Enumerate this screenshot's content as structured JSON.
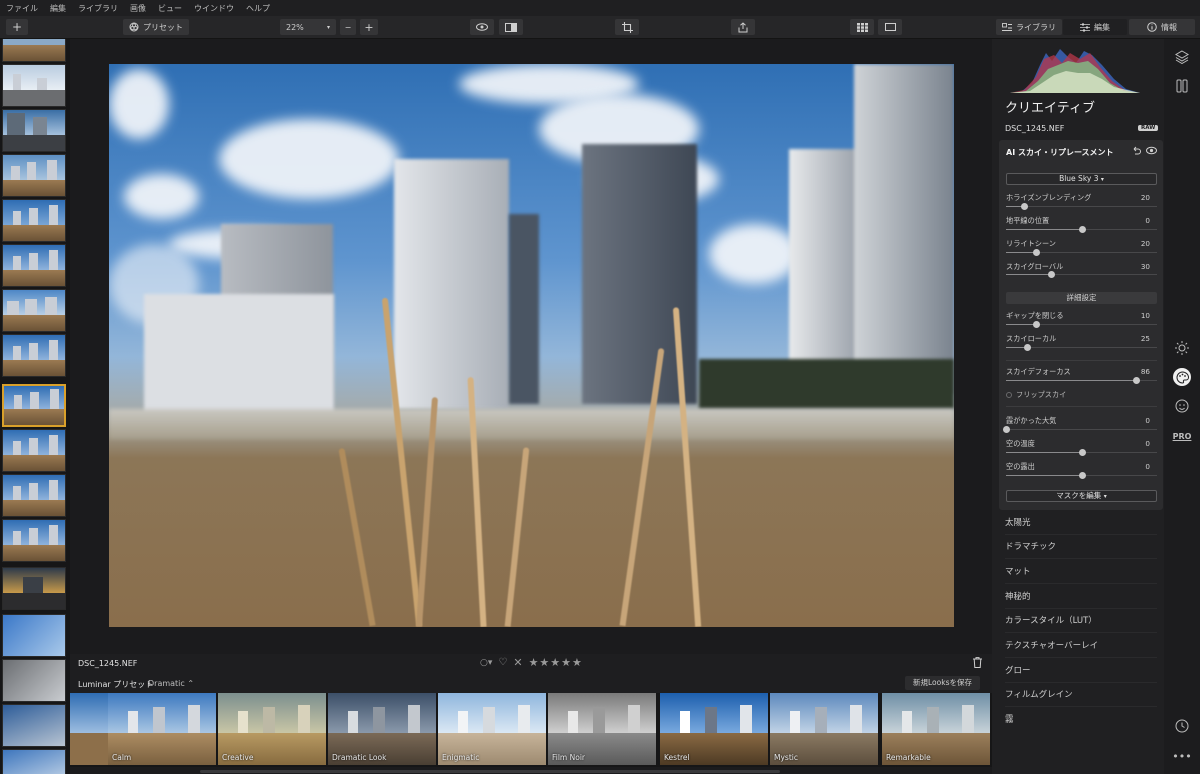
{
  "menu": [
    "ファイル",
    "編集",
    "ライブラリ",
    "画像",
    "ビュー",
    "ウインドウ",
    "ヘルプ"
  ],
  "toolbar": {
    "add_label": "+",
    "preset_label": "プリセット",
    "zoom": "22%",
    "zoom_minus": "−",
    "zoom_plus": "+",
    "tab_library": "ライブラリ",
    "tab_edit": "編集",
    "tab_info": "情報"
  },
  "file": {
    "name": "DSC_1245.NEF",
    "rating_stars": "★★★★★"
  },
  "presets": {
    "group": "Luminar プリセット",
    "category": "Dramatic",
    "save_label": "新規Looksを保存",
    "items": [
      "Calm",
      "Creative",
      "Dramatic Look",
      "Enigmatic",
      "Film Noir",
      "Kestrel",
      "Mystic",
      "Remarkable"
    ]
  },
  "panel": {
    "title": "クリエイティブ",
    "file": "DSC_1245.NEF",
    "badge": "RAW",
    "sky": {
      "title": "AI スカイ・リプレースメント",
      "sky_select": "Blue Sky 3",
      "sliders": [
        {
          "label": "ホライズンブレンディング",
          "value": "20",
          "pos": 0.12
        },
        {
          "label": "地平線の位置",
          "value": "0",
          "pos": 0.5
        },
        {
          "label": "リライトシーン",
          "value": "20",
          "pos": 0.2
        },
        {
          "label": "スカイグローバル",
          "value": "30",
          "pos": 0.3
        }
      ],
      "advanced_label": "詳細設定",
      "adv_sliders": [
        {
          "label": "ギャップを閉じる",
          "value": "10",
          "pos": 0.2
        },
        {
          "label": "スカイローカル",
          "value": "25",
          "pos": 0.14
        }
      ],
      "defocus": {
        "label": "スカイデフォーカス",
        "value": "86",
        "pos": 0.86
      },
      "flip_label": "フリップスカイ",
      "atmo_sliders": [
        {
          "label": "霞がかった大気",
          "value": "0",
          "pos": 0.0
        },
        {
          "label": "空の温度",
          "value": "0",
          "pos": 0.5
        },
        {
          "label": "空の露出",
          "value": "0",
          "pos": 0.5
        }
      ],
      "mask_label": "マスクを編集"
    },
    "tools": [
      "太陽光",
      "ドラマチック",
      "マット",
      "神秘的",
      "カラースタイル（LUT）",
      "テクスチャオーバーレイ",
      "グロー",
      "フィルムグレイン",
      "霧"
    ]
  },
  "strip": {
    "pro_label": "PRO"
  }
}
